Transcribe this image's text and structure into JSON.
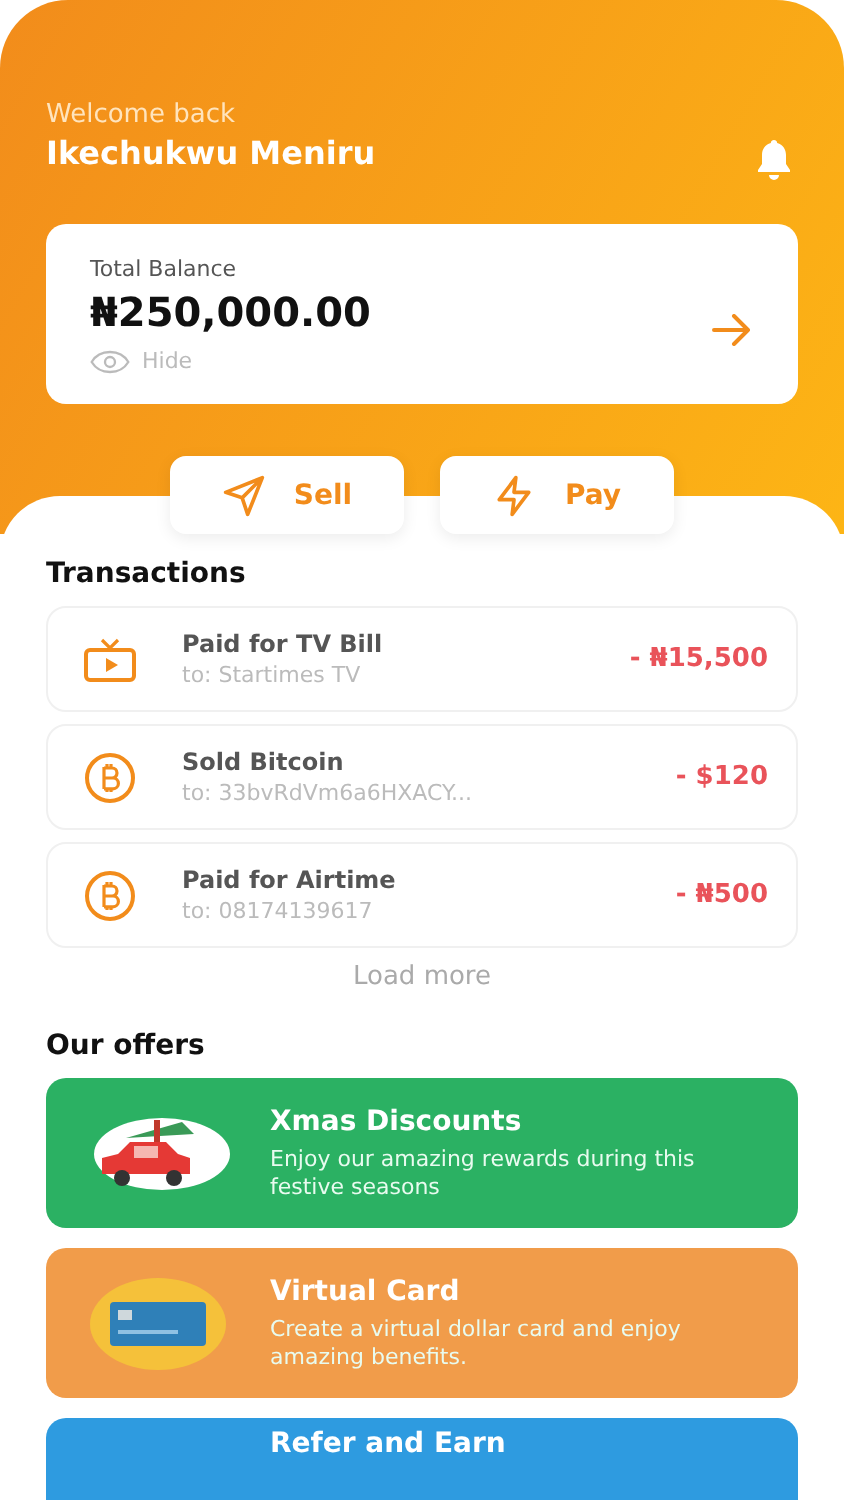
{
  "header": {
    "greeting": "Welcome back",
    "user_name": "Ikechukwu Meniru"
  },
  "balance": {
    "label": "Total Balance",
    "amount": "₦250,000.00",
    "hide_label": "Hide"
  },
  "actions": [
    {
      "kind": "sell",
      "label": "Sell"
    },
    {
      "kind": "pay",
      "label": "Pay"
    }
  ],
  "transactions": {
    "title": "Transactions",
    "items": [
      {
        "kind": "tv",
        "title": "Paid for TV Bill",
        "recipient": "to: Startimes TV",
        "amount": "- ₦15,500"
      },
      {
        "kind": "bitcoin",
        "title": "Sold Bitcoin",
        "recipient": "to: 33bvRdVm6a6HXACY...",
        "amount": "- $120"
      },
      {
        "kind": "bitcoin",
        "title": "Paid for Airtime",
        "recipient": "to: 08174139617",
        "amount": "- ₦500"
      }
    ],
    "load_more": "Load more"
  },
  "offers": {
    "title": "Our offers",
    "items": [
      {
        "kind": "xmas",
        "title": "Xmas Discounts",
        "description": "Enjoy our amazing rewards during this festive seasons",
        "color": "#2bb163"
      },
      {
        "kind": "card",
        "title": "Virtual Card",
        "description": "Create a virtual dollar card and enjoy amazing benefits.",
        "color": "#f19c4a"
      },
      {
        "kind": "refer",
        "title": "Refer and Earn",
        "color": "#2e9be0"
      }
    ]
  }
}
